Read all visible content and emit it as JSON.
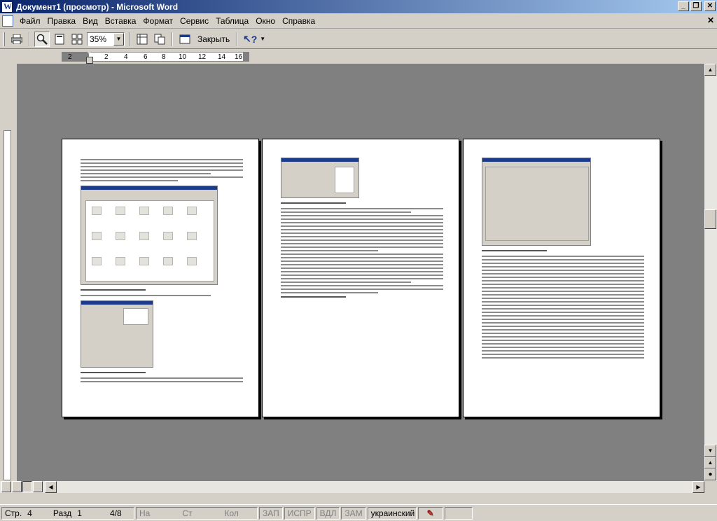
{
  "window": {
    "title": "Документ1 (просмотр) - Microsoft Word",
    "minimize": "_",
    "restore": "❐",
    "close": "✕"
  },
  "menu": {
    "items": [
      "Файл",
      "Правка",
      "Вид",
      "Вставка",
      "Формат",
      "Сервис",
      "Таблица",
      "Окно",
      "Справка"
    ],
    "close_doc": "✕"
  },
  "toolbar": {
    "zoom": "35%",
    "close_label": "Закрыть",
    "help": "?"
  },
  "ruler": {
    "marks": [
      "2",
      "2",
      "4",
      "6",
      "8",
      "10",
      "12",
      "14",
      "16"
    ]
  },
  "statusbar": {
    "page": "Стр.",
    "page_num": "4",
    "section": "Разд",
    "section_num": "1",
    "pages": "4/8",
    "at": "На",
    "line": "Ст",
    "col": "Кол",
    "rec": "ЗАП",
    "trk": "ИСПР",
    "ext": "ВДЛ",
    "ovr": "ЗАМ",
    "language": "украинский"
  }
}
